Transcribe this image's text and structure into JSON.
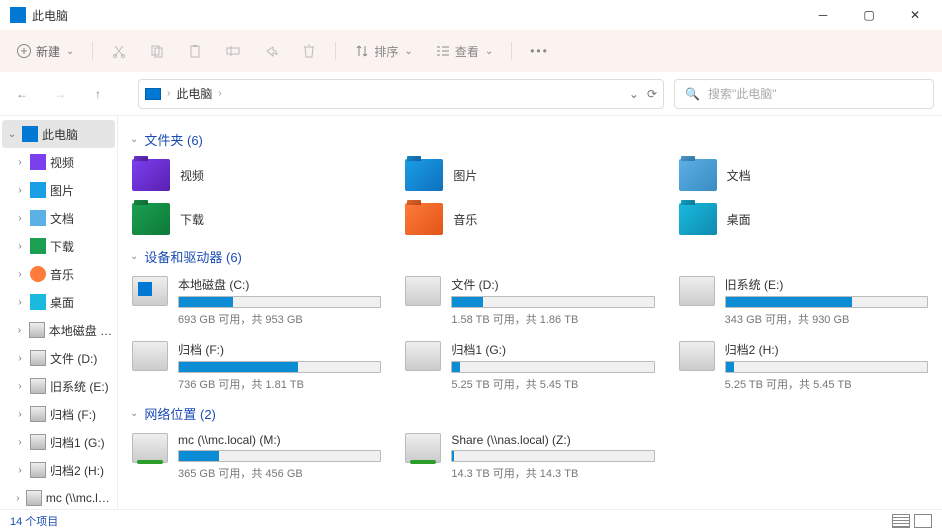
{
  "window_title": "此电脑",
  "toolbar": {
    "new_label": "新建",
    "sort_label": "排序",
    "view_label": "查看"
  },
  "address": {
    "crumb": "此电脑",
    "search_placeholder": "搜索\"此电脑\""
  },
  "sidebar": [
    {
      "label": "此电脑",
      "icon": "si-pc",
      "expanded": true,
      "selected": true
    },
    {
      "label": "视频",
      "icon": "si-vid",
      "indent": 1
    },
    {
      "label": "图片",
      "icon": "si-pic",
      "indent": 1
    },
    {
      "label": "文档",
      "icon": "si-doc",
      "indent": 1
    },
    {
      "label": "下载",
      "icon": "si-down",
      "indent": 1
    },
    {
      "label": "音乐",
      "icon": "si-music",
      "indent": 1
    },
    {
      "label": "桌面",
      "icon": "si-desk",
      "indent": 1
    },
    {
      "label": "本地磁盘 (C:)",
      "icon": "si-drive",
      "indent": 1
    },
    {
      "label": "文件 (D:)",
      "icon": "si-drive",
      "indent": 1
    },
    {
      "label": "旧系统 (E:)",
      "icon": "si-drive",
      "indent": 1
    },
    {
      "label": "归档 (F:)",
      "icon": "si-drive",
      "indent": 1
    },
    {
      "label": "归档1 (G:)",
      "icon": "si-drive",
      "indent": 1
    },
    {
      "label": "归档2 (H:)",
      "icon": "si-drive",
      "indent": 1
    },
    {
      "label": "mc (\\\\mc.local) (M:)",
      "icon": "si-drive",
      "indent": 1
    }
  ],
  "sections": {
    "folders": {
      "title": "文件夹 (6)"
    },
    "drives": {
      "title": "设备和驱动器 (6)"
    },
    "network": {
      "title": "网络位置 (2)"
    }
  },
  "folders": [
    {
      "label": "视频",
      "cls": "ic-video"
    },
    {
      "label": "图片",
      "cls": "ic-pic"
    },
    {
      "label": "文档",
      "cls": "ic-doc"
    },
    {
      "label": "下载",
      "cls": "ic-down"
    },
    {
      "label": "音乐",
      "cls": "ic-music"
    },
    {
      "label": "桌面",
      "cls": "ic-desk"
    }
  ],
  "drives": [
    {
      "label": "本地磁盘 (C:)",
      "info": "693 GB 可用，共 953 GB",
      "pct": 27,
      "win": true
    },
    {
      "label": "文件 (D:)",
      "info": "1.58 TB 可用，共 1.86 TB",
      "pct": 15
    },
    {
      "label": "旧系统 (E:)",
      "info": "343 GB 可用，共 930 GB",
      "pct": 63
    },
    {
      "label": "归档 (F:)",
      "info": "736 GB 可用，共 1.81 TB",
      "pct": 59
    },
    {
      "label": "归档1 (G:)",
      "info": "5.25 TB 可用，共 5.45 TB",
      "pct": 4
    },
    {
      "label": "归档2 (H:)",
      "info": "5.25 TB 可用，共 5.45 TB",
      "pct": 4
    }
  ],
  "network": [
    {
      "label": "mc (\\\\mc.local) (M:)",
      "info": "365 GB 可用，共 456 GB",
      "pct": 20
    },
    {
      "label": "Share (\\\\nas.local) (Z:)",
      "info": "14.3 TB 可用，共 14.3 TB",
      "pct": 1
    }
  ],
  "status": {
    "count_label": "14 个项目"
  }
}
